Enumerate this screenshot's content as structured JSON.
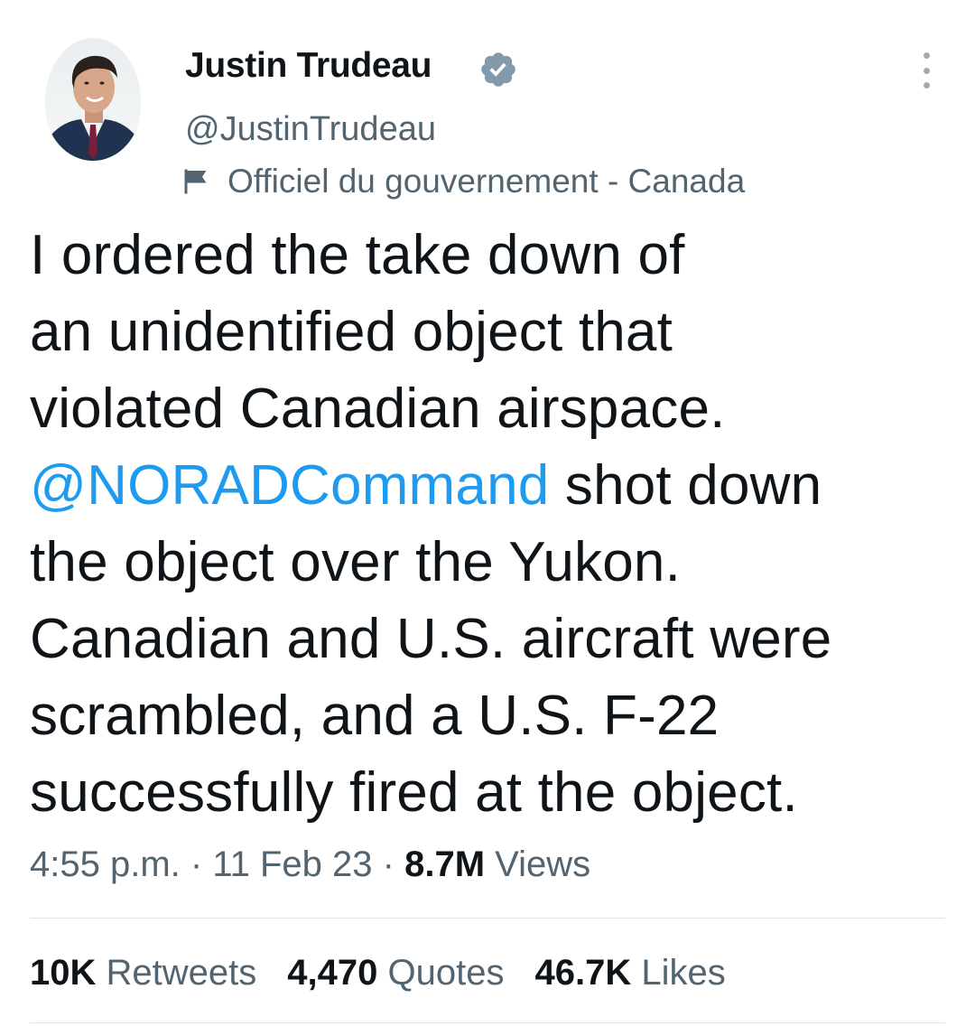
{
  "tweet": {
    "author": {
      "name": "Justin Trudeau",
      "handle": "@JustinTrudeau",
      "label": "Officiel du gouvernement - Canada"
    },
    "text_lines": [
      "I ordered the take down of",
      "an unidentified object that",
      "violated Canadian airspace."
    ],
    "mention": "@NORADCommand",
    "mention_rest": " shot down",
    "text_lines_after": [
      "the object over the Yukon.",
      "Canadian and U.S. aircraft were",
      "scrambled, and a U.S. F-22",
      "successfully fired at the object."
    ],
    "time": "4:55 p.m.",
    "separator": "·",
    "date": "11 Feb 23",
    "views_count": "8.7M",
    "views_label": "Views",
    "stats": [
      {
        "count": "10K",
        "label": "Retweets"
      },
      {
        "count": "4,470",
        "label": "Quotes"
      },
      {
        "count": "46.7K",
        "label": "Likes"
      }
    ]
  },
  "icons": {
    "verified": "verified-badge-icon",
    "flag": "flag-icon",
    "more": "more-options-icon"
  },
  "colors": {
    "text": "#0f1419",
    "secondary": "#536471",
    "link": "#1d9bf0",
    "verified_badge": "#829aab",
    "divider": "#dde3e8"
  }
}
